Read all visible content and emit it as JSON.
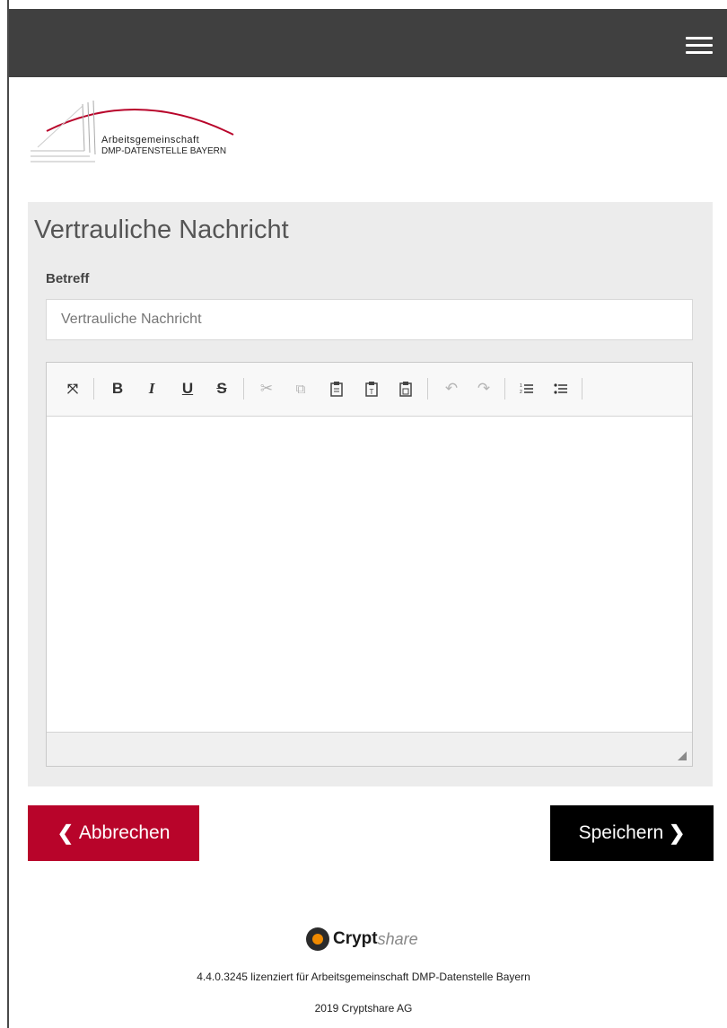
{
  "header": {
    "menu_icon": "hamburger-icon"
  },
  "logo": {
    "line1": "Arbeitsgemeinschaft",
    "line2": "DMP-DATENSTELLE BAYERN",
    "arc_color": "#b8042a"
  },
  "form": {
    "title": "Vertrauliche Nachricht",
    "subject_label": "Betreff",
    "subject_placeholder": "Vertrauliche Nachricht",
    "subject_value": ""
  },
  "editor": {
    "toolbar": [
      {
        "icon": "maximize-icon",
        "glyph": "⤧",
        "enabled": true
      },
      {
        "icon": "bold-icon",
        "glyph": "B",
        "enabled": true
      },
      {
        "icon": "italic-icon",
        "glyph": "I",
        "enabled": true
      },
      {
        "icon": "underline-icon",
        "glyph": "U",
        "enabled": true
      },
      {
        "icon": "strikethrough-icon",
        "glyph": "S",
        "enabled": true
      },
      {
        "icon": "cut-icon",
        "glyph": "✂",
        "enabled": false
      },
      {
        "icon": "copy-icon",
        "glyph": "⧉",
        "enabled": false
      },
      {
        "icon": "paste-icon",
        "glyph": "📋",
        "enabled": true
      },
      {
        "icon": "paste-text-icon",
        "glyph": "T",
        "enabled": true
      },
      {
        "icon": "paste-word-icon",
        "glyph": "W",
        "enabled": true
      },
      {
        "icon": "undo-icon",
        "glyph": "↶",
        "enabled": false
      },
      {
        "icon": "redo-icon",
        "glyph": "↷",
        "enabled": false
      },
      {
        "icon": "numbered-list-icon",
        "glyph": "☰",
        "enabled": true
      },
      {
        "icon": "bulleted-list-icon",
        "glyph": "☰",
        "enabled": true
      }
    ],
    "content": ""
  },
  "actions": {
    "cancel_label": "Abbrechen",
    "save_label": "Speichern",
    "cancel_color": "#b8042a",
    "save_color": "#000000"
  },
  "footer": {
    "brand_bold": "Crypt",
    "brand_light": "share",
    "license": "4.4.0.3245 lizenziert für Arbeitsgemeinschaft DMP-Datenstelle Bayern",
    "copyright": "2019 Cryptshare AG"
  }
}
